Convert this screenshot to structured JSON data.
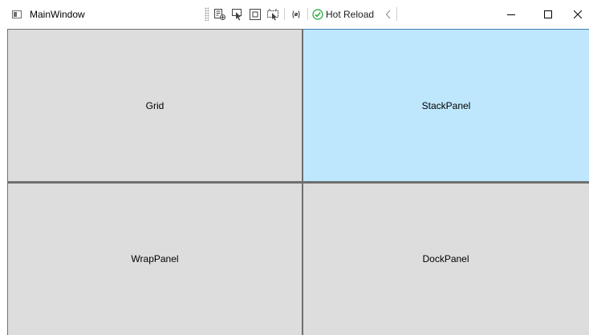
{
  "window": {
    "title": "MainWindow"
  },
  "devbar": {
    "tools": [
      {
        "icon": "live-visual-tree-icon"
      },
      {
        "icon": "select-element-icon"
      },
      {
        "icon": "display-layout-adorners-icon"
      },
      {
        "icon": "track-focused-element-icon"
      },
      {
        "icon": "binding-failures-icon"
      }
    ],
    "hot_reload_label": "Hot Reload",
    "hot_reload_status_icon": "check-circle-icon",
    "collapse_icon": "chevron-left-icon",
    "status_color": "#16a32c"
  },
  "caption": {
    "minimize_icon": "minimize-icon",
    "maximize_icon": "maximize-icon",
    "close_icon": "close-icon"
  },
  "panels": [
    {
      "label": "Grid",
      "highlighted": false
    },
    {
      "label": "StackPanel",
      "highlighted": true
    },
    {
      "label": "WrapPanel",
      "highlighted": false
    },
    {
      "label": "DockPanel",
      "highlighted": false
    }
  ],
  "colors": {
    "panel_background": "#dddddd",
    "panel_hover": "#bee6fd",
    "panel_border": "#707070"
  }
}
